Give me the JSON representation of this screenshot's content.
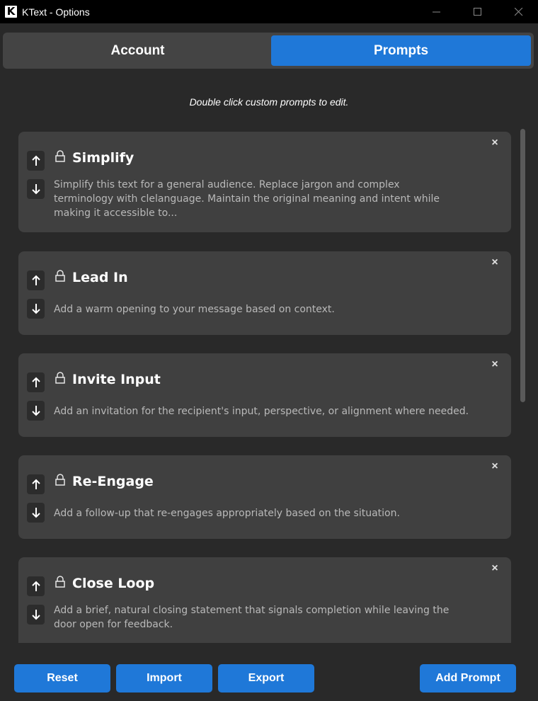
{
  "window": {
    "title": "KText - Options",
    "logo_letter": "K"
  },
  "tabs": [
    {
      "label": "Account",
      "active": false
    },
    {
      "label": "Prompts",
      "active": true
    }
  ],
  "hint": "Double click custom prompts to edit.",
  "prompts": [
    {
      "title": "Simplify",
      "description": "Simplify this text for a general audience. Replace jargon and complex terminology with clelanguage. Maintain the original meaning and intent while making it accessible to...",
      "locked": true
    },
    {
      "title": "Lead In",
      "description": "Add a warm opening to your message based on context.",
      "locked": true
    },
    {
      "title": "Invite Input",
      "description": "Add an invitation for the recipient's input, perspective, or alignment where needed.",
      "locked": true
    },
    {
      "title": "Re-Engage",
      "description": "Add a follow-up that re-engages appropriately based on the situation.",
      "locked": true
    },
    {
      "title": "Close Loop",
      "description": "Add a brief, natural closing statement that signals completion while leaving the door open for feedback.",
      "locked": true
    }
  ],
  "footer": {
    "reset_label": "Reset",
    "import_label": "Import",
    "export_label": "Export",
    "add_label": "Add Prompt"
  },
  "colors": {
    "accent": "#1f78d8",
    "background": "#292929",
    "card": "#404040",
    "titlebar": "#000000"
  },
  "icons": {
    "up": "arrow-up-icon",
    "down": "arrow-down-icon",
    "lock": "lock-icon",
    "close": "close-icon"
  }
}
